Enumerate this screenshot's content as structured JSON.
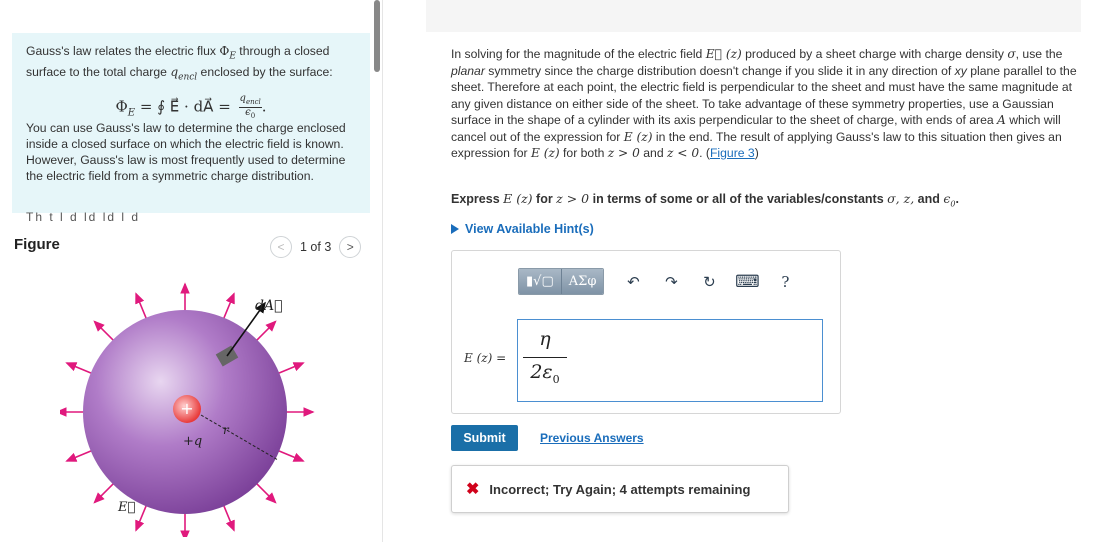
{
  "intro": {
    "line1_pre": "Gauss's law relates the electric flux ",
    "flux_symbol": "Φ",
    "flux_sub": "E",
    "line1_post": " through a closed surface to the total charge ",
    "charge_symbol": "q",
    "charge_sub": "encl",
    "line1_end": " enclosed by the surface:",
    "formula_lhs": "Φ",
    "formula_lhs_sub": "E",
    "formula_mid": " = ∮ E⃗ · dA⃗ = ",
    "formula_num": "q",
    "formula_num_sub": "encl",
    "formula_den": "ϵ",
    "formula_den_sub": "0",
    "formula_end": ".",
    "body": "You can use Gauss's law to determine the charge enclosed inside a closed surface on which the electric field is known. However, Gauss's law is most frequently used to determine the electric field from a symmetric charge distribution.",
    "cut_text": "Th   t l   d   ld   ld   l   d"
  },
  "figure": {
    "label": "Figure",
    "pager_text": "1 of 3",
    "prev_symbol": "<",
    "next_symbol": ">",
    "label_dA": "dA⃗",
    "label_q": "+q",
    "label_r": "r",
    "label_E": "E⃗",
    "plus_sign": "+"
  },
  "description": {
    "text1": "In solving for the magnitude of the electric field ",
    "e_z": "E⃗ (z)",
    "text2": " produced by a sheet charge with charge density ",
    "sigma": "σ",
    "text3": ", use the ",
    "planar": "planar",
    "text4": " symmetry since the charge distribution doesn't change if you slide it in any direction of ",
    "xy": "xy",
    "text5": " plane parallel to the sheet. Therefore at each point, the electric field is perpendicular to the sheet and must have the same magnitude at any given distance on either side of the sheet. To take advantage of these symmetry properties, use a Gaussian surface in the shape of a cylinder with its axis perpendicular to the sheet of charge, with ends of area ",
    "A": "A",
    "text6": " which will cancel out of the expression for ",
    "E_z1": "E (z)",
    "text7": " in the end. The result of applying Gauss's law to this situation then gives an expression for ",
    "E_z2": "E (z)",
    "text8": " for both ",
    "cond1": "z > 0",
    "text9": " and ",
    "cond2": "z < 0",
    "text10": ". (",
    "fig_link": "Figure 3",
    "text11": ")"
  },
  "express": {
    "pre": "Express ",
    "E_z": "E (z)",
    "mid": " for ",
    "cond": "z > 0",
    "post": " in terms of some or all of the variables/constants ",
    "vars": "σ, z,",
    "and": " and ",
    "eps": "ϵ",
    "eps_sub": "0",
    "end": "."
  },
  "hint": {
    "label": "View Available Hint(s)"
  },
  "toolbar": {
    "template_btn": "▮√▢",
    "greek_btn": "ΑΣφ",
    "undo_icon": "↶",
    "redo_icon": "↷",
    "reset_icon": "↻",
    "keyboard_icon": "⌨",
    "help_icon": "?"
  },
  "answer": {
    "label": "E (z) =",
    "numerator": "η",
    "denominator": "2ε",
    "denominator_sub": "0"
  },
  "buttons": {
    "submit": "Submit",
    "previous_answers": "Previous Answers"
  },
  "feedback": {
    "icon": "✖",
    "text": "Incorrect; Try Again; 4 attempts remaining"
  },
  "colors": {
    "intro_bg": "#e6f6f9",
    "link": "#1a6dbb",
    "submit_bg": "#1a6fa8",
    "error": "#d0021b",
    "sphere": "#9a5cb4",
    "field_arrow": "#e0197d"
  }
}
